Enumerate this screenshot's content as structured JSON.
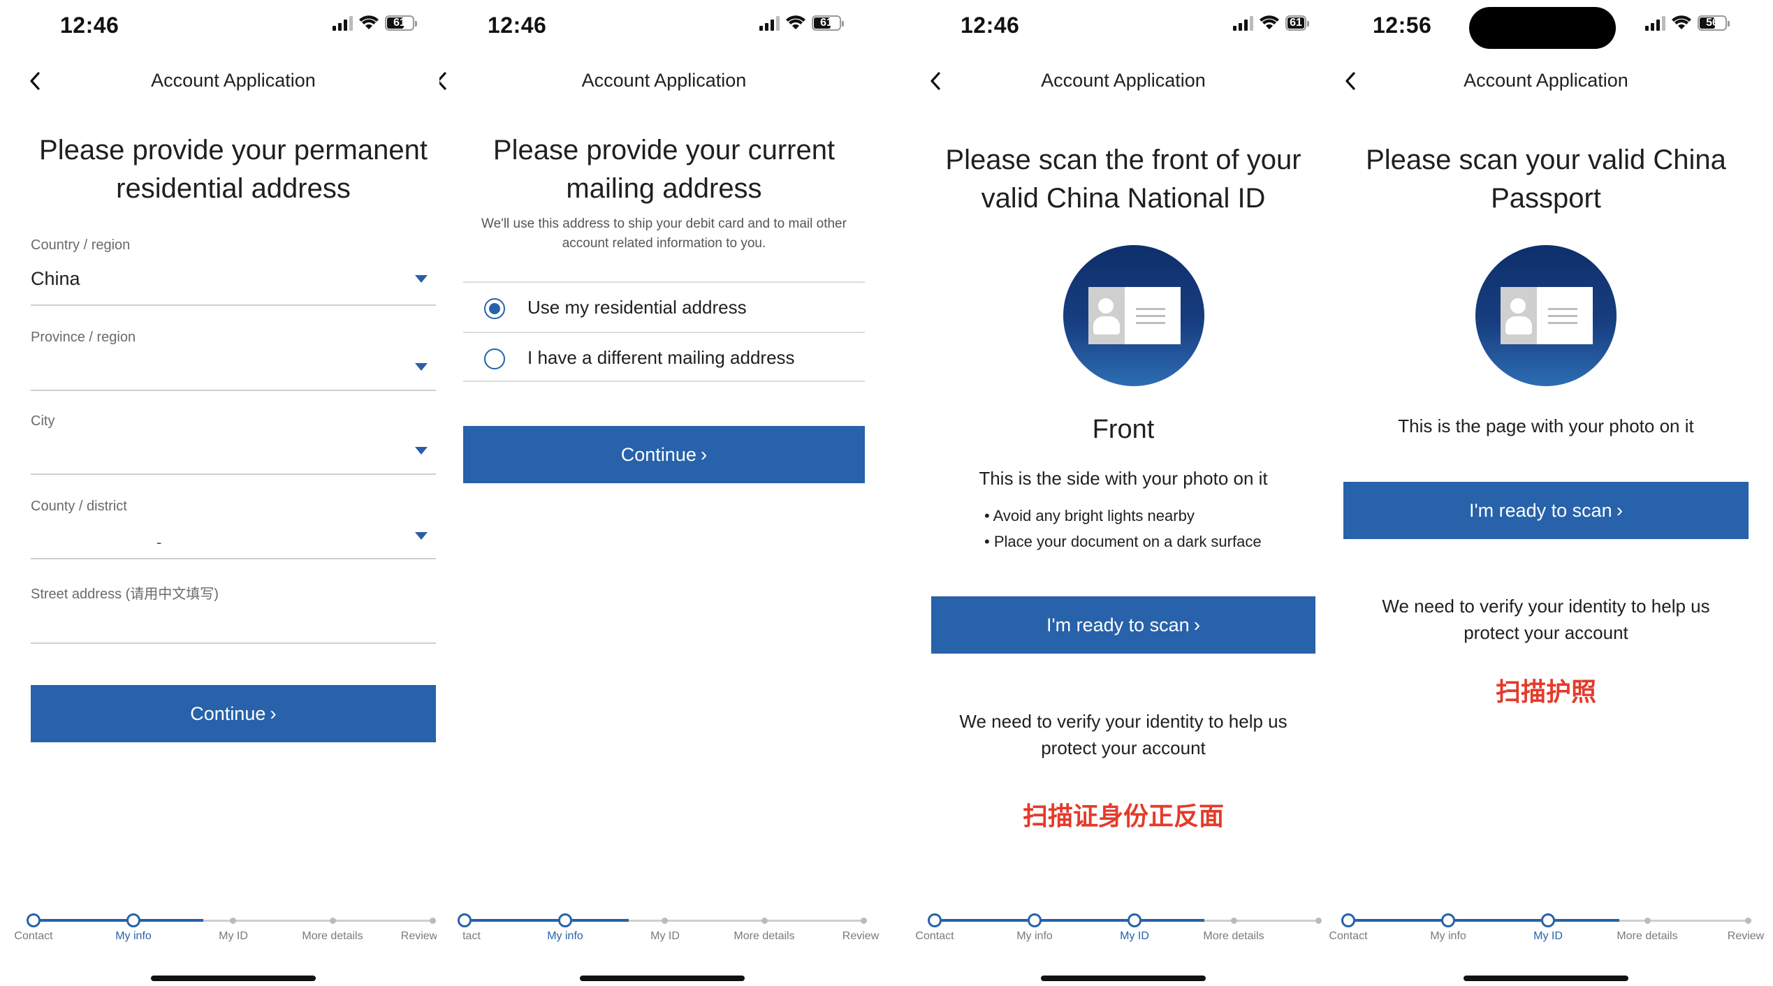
{
  "screens": [
    {
      "time": "12:46",
      "battery": "61",
      "nav_title": "Account Application",
      "heading_line1": "Please provide your permanent",
      "heading_line2": "residential address",
      "fields": [
        {
          "label": "Country / region",
          "value": "China"
        },
        {
          "label": "Province / region",
          "value": ""
        },
        {
          "label": "City",
          "value": ""
        },
        {
          "label": "County / district",
          "value": "-"
        },
        {
          "label": "Street address (请用中文填写)",
          "value": ""
        }
      ],
      "button": "Continue",
      "steps": [
        "Contact",
        "My info",
        "My ID",
        "More details",
        "Review"
      ],
      "active_step": "My info"
    },
    {
      "time": "12:46",
      "battery": "61",
      "nav_title": "Account Application",
      "heading_line1": "Please provide your current",
      "heading_line2": "mailing address",
      "subtext_line1": "We'll use this address to ship your debit card and to mail other",
      "subtext_line2": "account related information to you.",
      "options": [
        {
          "label": "Use my residential address",
          "selected": true
        },
        {
          "label": "I have a different mailing address",
          "selected": false
        }
      ],
      "button": "Continue",
      "steps": [
        "tact",
        "My info",
        "My ID",
        "More details",
        "Review"
      ],
      "active_step": "My info"
    },
    {
      "time": "12:46",
      "battery": "61",
      "nav_title": "Account Application",
      "heading_line1": "Please scan the front of your",
      "heading_line2": "valid China National ID",
      "side_title": "Front",
      "side_desc": "This is the side with your photo on it",
      "tips": [
        "• Avoid any bright lights nearby",
        "• Place your document on a dark surface"
      ],
      "button": "I'm ready to scan",
      "verify_line1": "We need to verify your identity to help us",
      "verify_line2": "protect your account",
      "annotation": "扫描证身份正反面",
      "steps": [
        "Contact",
        "My info",
        "My ID",
        "More details",
        "Review"
      ],
      "active_step": "My ID"
    },
    {
      "time": "12:56",
      "battery": "56",
      "nav_title": "Account Application",
      "heading_line1": "Please scan your valid China",
      "heading_line2": "Passport",
      "side_desc": "This is the page with your photo on it",
      "button": "I'm ready to scan",
      "verify_line1": "We need to verify your identity to help us",
      "verify_line2": "protect your account",
      "annotation": "扫描护照",
      "steps": [
        "Contact",
        "My info",
        "My ID",
        "More details",
        "Review"
      ],
      "active_step": "My ID"
    }
  ],
  "colors": {
    "primary": "#2762aa",
    "annotation": "#e53a2a",
    "circle_dark": "#0e2f6b"
  },
  "icons": [
    "back-chevron-icon",
    "signal-icon",
    "wifi-icon",
    "battery-icon",
    "dropdown-caret-icon",
    "chevron-right-icon",
    "id-card-icon"
  ]
}
